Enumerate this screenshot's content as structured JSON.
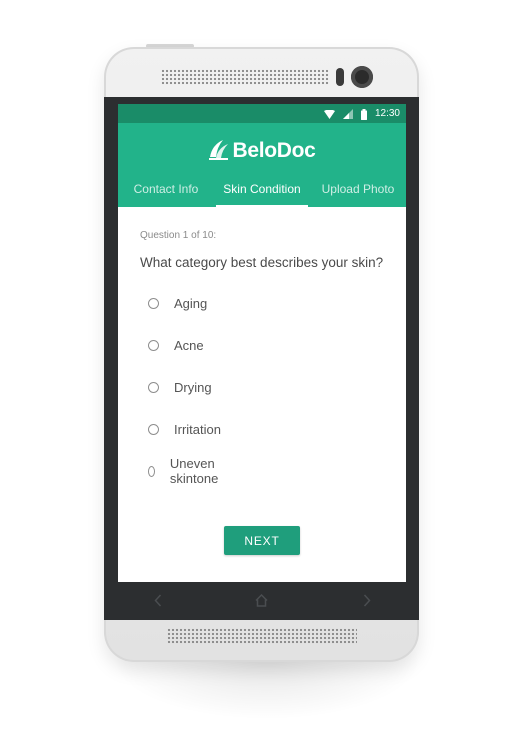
{
  "status_bar": {
    "time": "12:30",
    "icons": [
      "wifi-icon",
      "signal-icon",
      "battery-icon"
    ]
  },
  "app": {
    "name": "BeloDoc",
    "accent_color": "#22b38a",
    "button_color": "#1f9e7c"
  },
  "tabs": [
    {
      "label": "Contact Info",
      "active": false
    },
    {
      "label": "Skin Condition",
      "active": true
    },
    {
      "label": "Upload Photo",
      "active": false
    }
  ],
  "question": {
    "counter": "Question 1 of 10:",
    "text": "What category best describes your skin?"
  },
  "options": [
    {
      "label": "Aging",
      "selected": false
    },
    {
      "label": "Acne",
      "selected": false
    },
    {
      "label": "Drying",
      "selected": false
    },
    {
      "label": "Irritation",
      "selected": false
    },
    {
      "label": "Uneven skintone",
      "selected": false
    }
  ],
  "next_button": {
    "label": "NEXT"
  },
  "nav_bar": {
    "icons": [
      "back-chevron-icon",
      "home-icon",
      "forward-chevron-icon"
    ]
  }
}
